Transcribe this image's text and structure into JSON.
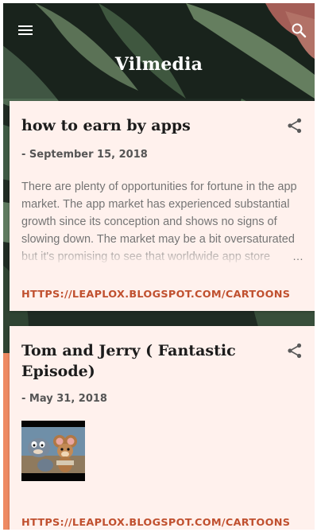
{
  "header": {
    "site_title": "Vilmedia",
    "menu_icon": "hamburger-menu-icon",
    "search_icon": "search-icon"
  },
  "posts": [
    {
      "title": "how to earn by apps",
      "date": "- September 15, 2018",
      "snippet": "There are plenty of opportunities for fortune in the app market. The app market has experienced substantial growth since its conception and shows no signs of slowing down. The market may be a bit oversaturated but it's promising to see that worldwide app store",
      "ellipsis": "…",
      "link": "HTTPS://LEAPLOX.BLOGSPOT.COM/CARTOONS",
      "share_icon": "share-icon"
    },
    {
      "title": "Tom and Jerry ( Fantastic Episode)",
      "date": "- May 31, 2018",
      "thumbnail_icon": "cartoon-thumbnail-image",
      "link": "HTTPS://LEAPLOX.BLOGSPOT.COM/CARTOONS",
      "share_icon": "share-icon"
    }
  ],
  "colors": {
    "card_background": "#fff1ed",
    "link_color": "#c0502f",
    "accent_orange": "#ee8a63",
    "header_background": "#1f2b23"
  }
}
